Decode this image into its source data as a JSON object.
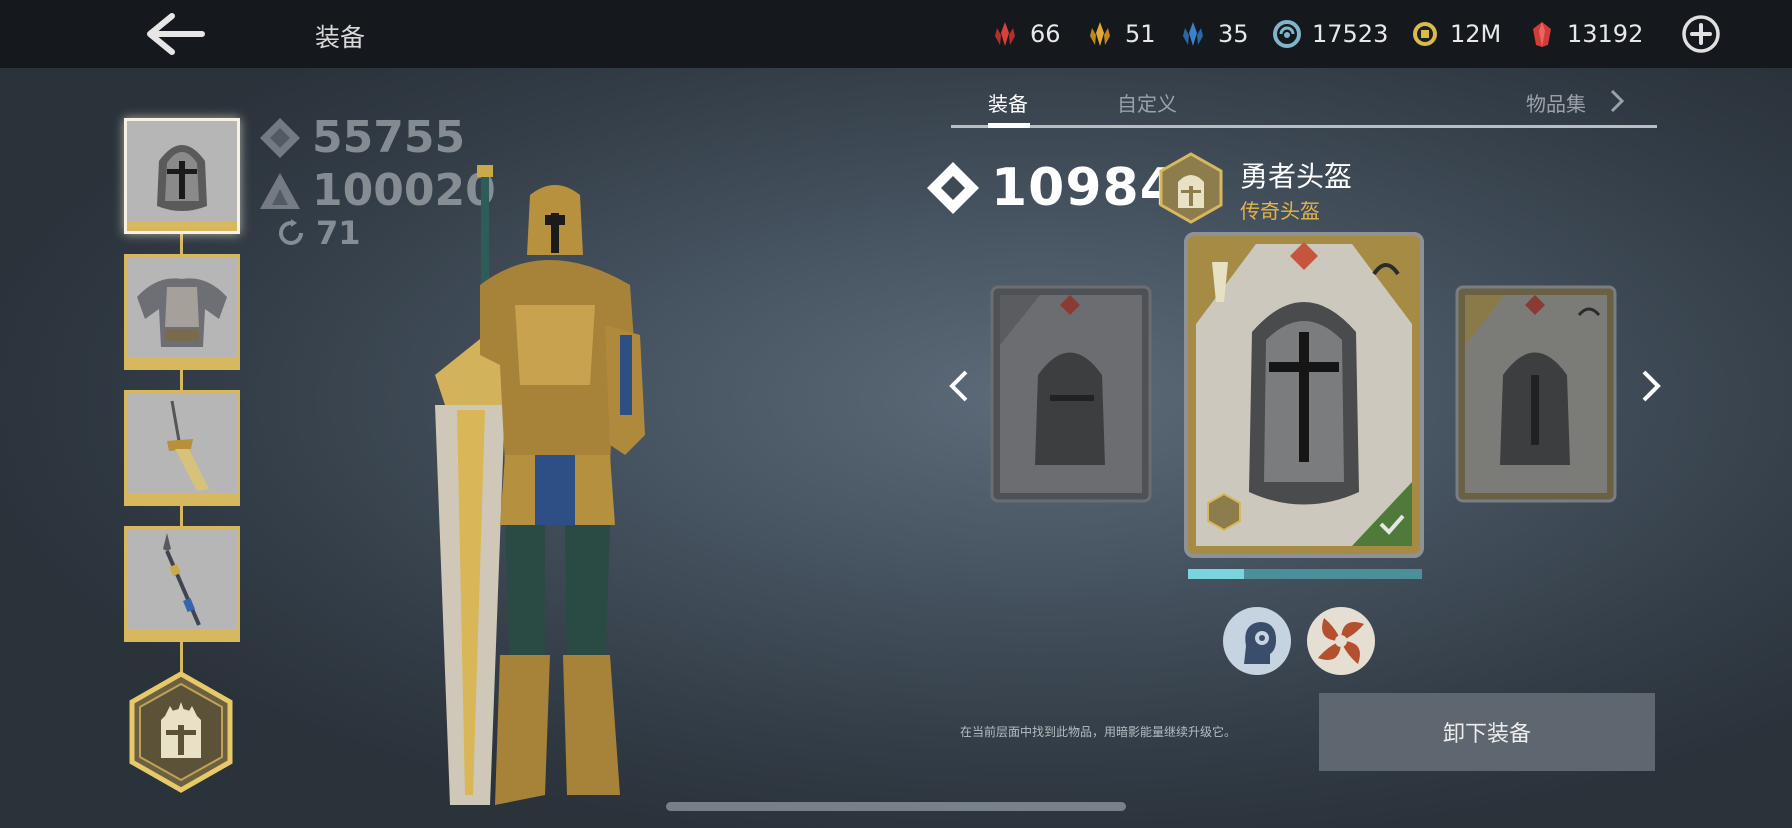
{
  "header": {
    "title": "装备",
    "back_icon": "back-arrow-icon",
    "add_icon": "plus-circle-icon"
  },
  "currencies": [
    {
      "name": "red-crystal-icon",
      "value": "66",
      "color": "#d8423b"
    },
    {
      "name": "gold-crystal-icon",
      "value": "51",
      "color": "#e2a93a"
    },
    {
      "name": "blue-crystal-icon",
      "value": "35",
      "color": "#3b82c9"
    },
    {
      "name": "shadow-energy-icon",
      "value": "17523",
      "color": "#7fb4c9"
    },
    {
      "name": "coin-icon",
      "value": "12M",
      "color": "#d8bb4c"
    },
    {
      "name": "ruby-gem-icon",
      "value": "13192",
      "color": "#d33b36"
    }
  ],
  "stats": {
    "power": "55755",
    "attack": "100020",
    "level": "71"
  },
  "slots": [
    {
      "name": "helmet-slot",
      "selected": true
    },
    {
      "name": "armor-slot",
      "selected": false
    },
    {
      "name": "sword-slot",
      "selected": false
    },
    {
      "name": "spear-slot",
      "selected": false
    }
  ],
  "tabs": [
    {
      "label": "装备",
      "active": true
    },
    {
      "label": "自定义",
      "active": false
    }
  ],
  "collection_label": "物品集",
  "item": {
    "power": "10984",
    "name": "勇者头盔",
    "rarity": "传奇头盔",
    "upgrade_progress": 0.24
  },
  "hint": "在当前层面中找到此物品，用暗影能量继续升级它。",
  "unequip_label": "卸下装备",
  "colors": {
    "gold": "#d7b85e",
    "legendary_text": "#e3b54a",
    "topbar": "#15191d"
  }
}
